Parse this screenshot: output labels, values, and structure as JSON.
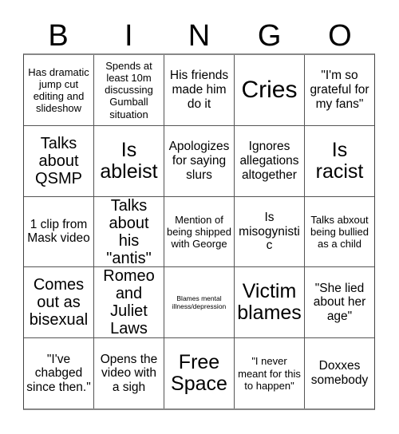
{
  "card": {
    "title": "BINGO",
    "header_letters": [
      "B",
      "I",
      "N",
      "G",
      "O"
    ],
    "free_space_label": "Free Space",
    "colors": {
      "background": "#ffffff",
      "text": "#000000",
      "grid_line": "#555555",
      "grid_border": "#888888"
    },
    "rows": [
      [
        {
          "text": "Has dramatic jump cut editing and slideshow",
          "size": "s"
        },
        {
          "text": "Spends at least 10m discussing Gumball situation",
          "size": "s"
        },
        {
          "text": "His friends made him do it",
          "size": "m"
        },
        {
          "text": "Cries",
          "size": "xxl"
        },
        {
          "text": "\"I'm so grateful for my fans\"",
          "size": "m"
        }
      ],
      [
        {
          "text": "Talks about QSMP",
          "size": "l"
        },
        {
          "text": "Is ableist",
          "size": "xl"
        },
        {
          "text": "Apologizes for saying slurs",
          "size": "m"
        },
        {
          "text": "Ignores allegations altogether",
          "size": "m"
        },
        {
          "text": "Is racist",
          "size": "xl"
        }
      ],
      [
        {
          "text": "1 clip from Mask video",
          "size": "m"
        },
        {
          "text": "Talks about his \"antis\"",
          "size": "l"
        },
        {
          "text": "Mention of being shipped with George",
          "size": "s"
        },
        {
          "text": "Is misogynistic",
          "size": "m"
        },
        {
          "text": "Talks abxout being bullied as a child",
          "size": "s"
        }
      ],
      [
        {
          "text": "Comes out as bisexual",
          "size": "l"
        },
        {
          "text": "Romeo and Juliet Laws",
          "size": "l"
        },
        {
          "text": "Blames mental illness/depression",
          "size": "xxs"
        },
        {
          "text": "Victim blames",
          "size": "xl"
        },
        {
          "text": "\"She lied about her age\"",
          "size": "m"
        }
      ],
      [
        {
          "text": "\"I've chabged since then.\"",
          "size": "m"
        },
        {
          "text": "Opens the video with a sigh",
          "size": "m"
        },
        {
          "text": "Free Space",
          "size": "xl"
        },
        {
          "text": "\"I never meant for this to happen\"",
          "size": "s"
        },
        {
          "text": "Doxxes somebody",
          "size": "m"
        }
      ]
    ]
  }
}
